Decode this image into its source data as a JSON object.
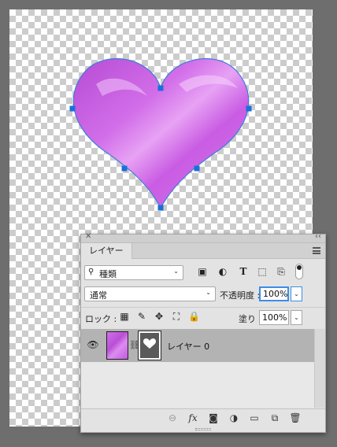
{
  "colors": {
    "heart_fill": "#cc5ee6",
    "path_stroke": "#3b7fd9",
    "anchor": "#1b6fd8",
    "focus": "#3b8ee6"
  },
  "layers_panel": {
    "tab_label": "レイヤー",
    "close_icon": "close-x",
    "collapse_icon": "double-chevron",
    "filter": {
      "kind_label": "種類",
      "icons": [
        "pixel-filter-icon",
        "adjustment-filter-icon",
        "type-filter-icon",
        "shape-filter-icon",
        "smart-object-filter-icon",
        "filter-toggle"
      ]
    },
    "blend_mode": "通常",
    "opacity_label": "不透明度 :",
    "opacity_value": "100%",
    "lock_label": "ロック :",
    "fill_label": "塗り :",
    "fill_value": "100%",
    "layers": [
      {
        "name": "レイヤー 0",
        "visible": true,
        "selected": true,
        "has_mask": true
      }
    ],
    "footer_icons": [
      "link-layers-icon",
      "fx-icon",
      "add-mask-icon",
      "adjustment-layer-icon",
      "group-icon",
      "new-layer-icon",
      "trash-icon"
    ]
  },
  "glyphs": {
    "close": "✕",
    "collapse": "‹‹",
    "search": "⚲",
    "dropdown": "⌄",
    "pixel": "▣",
    "adjust": "◐",
    "type": "T",
    "shape": "⬚",
    "smart": "⎘",
    "lock_transparent": "▦",
    "lock_paint": "✎",
    "lock_move": "✥",
    "lock_artboard": "⛶",
    "lock_all": "🔒",
    "eye": "👁",
    "chain": "⛓",
    "link": "⊖",
    "fx": "fx",
    "mask": "◙",
    "adjustment": "◑",
    "folder": "▭",
    "new_layer": "⧉",
    "trash": "🗑"
  }
}
